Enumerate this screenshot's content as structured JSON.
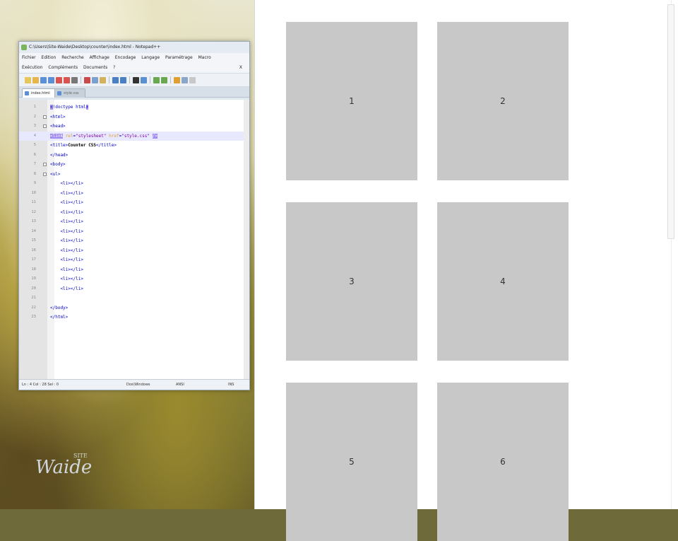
{
  "notepad": {
    "title": "C:\\Users\\Site-Waide\\Desktop\\counter\\index.html - Notepad++",
    "menu": [
      "Fichier",
      "Edition",
      "Recherche",
      "Affichage",
      "Encodage",
      "Langage",
      "Paramétrage",
      "Macro"
    ],
    "menu2": [
      "Exécution",
      "Compléments",
      "Documents",
      "?"
    ],
    "menu_close": "X",
    "tabs": [
      {
        "label": "index.html",
        "active": true
      },
      {
        "label": "style.css",
        "active": false
      }
    ],
    "lines": [
      {
        "n": "1",
        "html": "<span class='caret-bracket'>&lt;</span>!doctype html<span class='caret-bracket'>&gt;</span>"
      },
      {
        "n": "2",
        "html": "&lt;html&gt;",
        "fold": true
      },
      {
        "n": "3",
        "html": "&lt;head&gt;",
        "fold": true
      },
      {
        "n": "4",
        "html": "<span class='hl'>&lt;link</span> <span class='attr'>rel</span>=<span class='str'>\"stylesheet\"</span> <span class='attr'>href</span>=<span class='str'>\"style.css\"</span> <span class='hl'>/&gt;</span>",
        "current": true
      },
      {
        "n": "5",
        "html": "&lt;title&gt;<span class='txt'>Counter CSS</span>&lt;/title&gt;"
      },
      {
        "n": "6",
        "html": "&lt;/head&gt;"
      },
      {
        "n": "7",
        "html": "&lt;body&gt;",
        "fold": true
      },
      {
        "n": "8",
        "html": "&lt;ul&gt;",
        "fold": true
      },
      {
        "n": "9",
        "html": "    &lt;li&gt;&lt;/li&gt;"
      },
      {
        "n": "10",
        "html": "    &lt;li&gt;&lt;/li&gt;"
      },
      {
        "n": "11",
        "html": "    &lt;li&gt;&lt;/li&gt;"
      },
      {
        "n": "12",
        "html": "    &lt;li&gt;&lt;/li&gt;"
      },
      {
        "n": "13",
        "html": "    &lt;li&gt;&lt;/li&gt;"
      },
      {
        "n": "14",
        "html": "    &lt;li&gt;&lt;/li&gt;"
      },
      {
        "n": "15",
        "html": "    &lt;li&gt;&lt;/li&gt;"
      },
      {
        "n": "16",
        "html": "    &lt;li&gt;&lt;/li&gt;"
      },
      {
        "n": "17",
        "html": "    &lt;li&gt;&lt;/li&gt;"
      },
      {
        "n": "18",
        "html": "    &lt;li&gt;&lt;/li&gt;"
      },
      {
        "n": "19",
        "html": "    &lt;li&gt;&lt;/li&gt;"
      },
      {
        "n": "20",
        "html": "    &lt;li&gt;&lt;/li&gt;"
      },
      {
        "n": "21",
        "html": ""
      },
      {
        "n": "22",
        "html": "&lt;/body&gt;"
      },
      {
        "n": "23",
        "html": "&lt;/html&gt;"
      }
    ],
    "status": {
      "position": "Ln : 4    Col : 28    Sel : 0",
      "eol": "Dos\\Windows",
      "encoding": "ANSI",
      "mode": "INS"
    }
  },
  "browser": {
    "boxes": [
      "1",
      "2",
      "3",
      "4",
      "5",
      "6"
    ]
  },
  "logo": {
    "site": "SITE",
    "name": "Waide"
  }
}
